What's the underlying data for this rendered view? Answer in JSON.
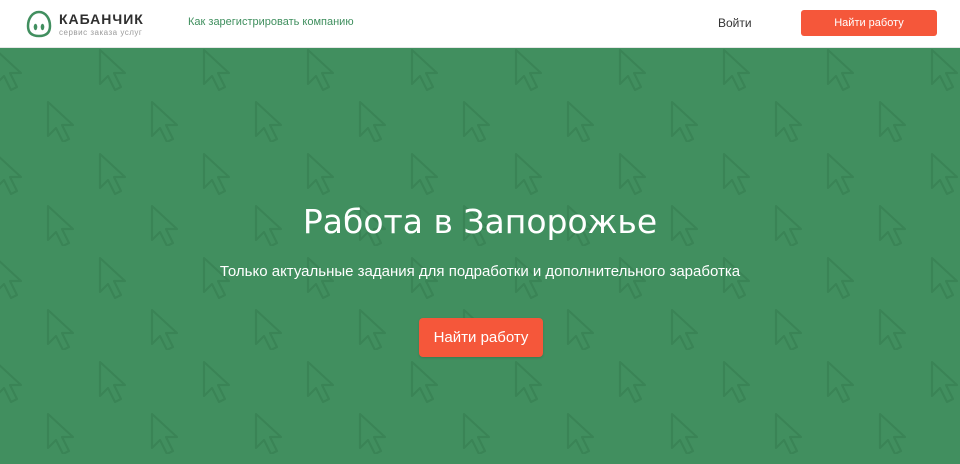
{
  "colors": {
    "brand_green": "#418f5f",
    "accent_orange": "#f5573a",
    "link_green": "#3f8f5e"
  },
  "header": {
    "logo": {
      "name": "КАБАНЧИК",
      "tagline": "сервис заказа услуг",
      "icon": "piggy-logo-icon"
    },
    "register_link": "Как зарегистрировать компанию",
    "login_link": "Войти",
    "cta_label": "Найти работу"
  },
  "hero": {
    "background_pattern_icon": "cursor-arrow-icon",
    "title": "Работа в Запорожье",
    "subtitle": "Только актуальные задания для подработки и дополнительного заработка",
    "cta_label": "Найти работу"
  }
}
